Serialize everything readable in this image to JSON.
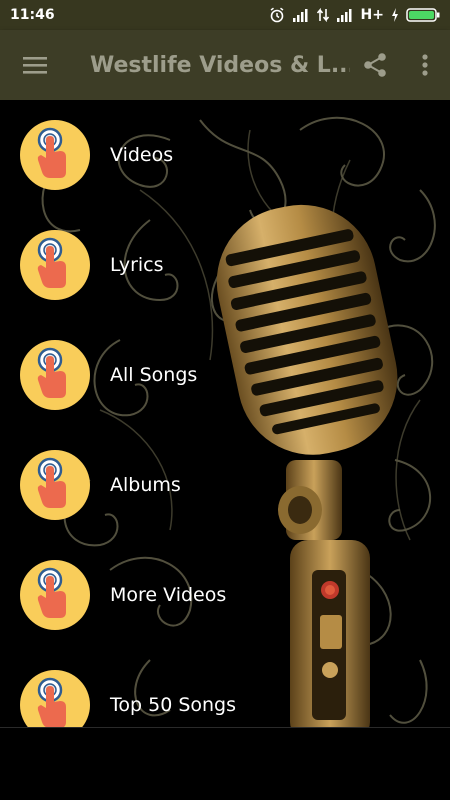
{
  "status_bar": {
    "time": "11:46",
    "network": "H+",
    "icons": [
      "alarm-icon",
      "signal-icon",
      "data-arrows-icon",
      "signal-icon",
      "charging-icon",
      "battery-icon"
    ]
  },
  "app_bar": {
    "title": "Westlife Videos & L...",
    "icons": [
      "menu-icon",
      "share-icon",
      "more-vert-icon"
    ],
    "background": "#3d3d26",
    "title_color": "#9d9d8b"
  },
  "menu": {
    "items": [
      {
        "label": "Videos",
        "icon": "tap-finger-icon"
      },
      {
        "label": "Lyrics",
        "icon": "tap-finger-icon"
      },
      {
        "label": "All Songs",
        "icon": "tap-finger-icon"
      },
      {
        "label": "Albums",
        "icon": "tap-finger-icon"
      },
      {
        "label": "More Videos",
        "icon": "tap-finger-icon"
      },
      {
        "label": "Top 50 Songs",
        "icon": "tap-finger-icon"
      }
    ]
  },
  "colors": {
    "icon_circle": "#f9cd5a",
    "finger": "#ec6a4e",
    "ring": "#2f5c92",
    "microphone": "#b89149"
  }
}
